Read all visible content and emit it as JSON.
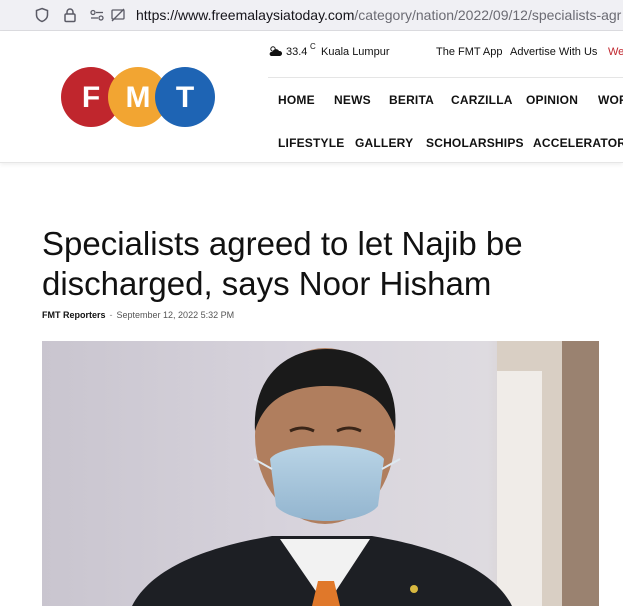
{
  "browser": {
    "url_host": "https://www.freemalaysiatoday.com",
    "url_path": "/category/nation/2022/09/12/specialists-agr"
  },
  "logo": {
    "letters": [
      "F",
      "M",
      "T"
    ],
    "colors": [
      "#c0262d",
      "#f2a532",
      "#1e64b4"
    ]
  },
  "weather": {
    "temperature": "33.4",
    "unit": "C",
    "city": "Kuala Lumpur",
    "icon": "cloud-sun-icon"
  },
  "top_links": {
    "app": "The FMT App",
    "advertise": "Advertise With Us",
    "truncated": "We"
  },
  "nav_row1": [
    "HOME",
    "NEWS",
    "BERITA",
    "CARZILLA",
    "OPINION",
    "WOR"
  ],
  "nav_row2": [
    "LIFESTYLE",
    "GALLERY",
    "SCHOLARSHIPS",
    "ACCELERATOR"
  ],
  "article": {
    "headline": "Specialists agreed to let Najib be discharged, says Noor Hisham",
    "author": "FMT Reporters",
    "separator": "-",
    "date": "September 12, 2022 5:32 PM"
  },
  "colors": {
    "logo_red": "#c0262d",
    "logo_orange": "#f2a532",
    "logo_blue": "#1e64b4"
  }
}
